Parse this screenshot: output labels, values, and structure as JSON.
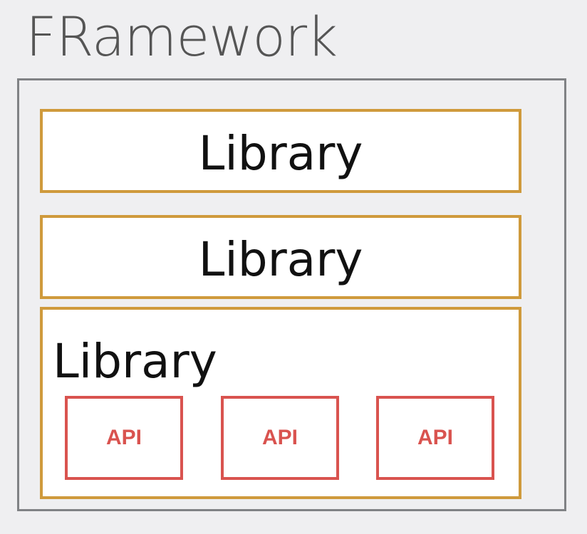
{
  "framework": {
    "title": "FRamework"
  },
  "libraries": [
    {
      "label": "Library"
    },
    {
      "label": "Library"
    },
    {
      "label": "Library"
    }
  ],
  "apis": [
    {
      "label": "API"
    },
    {
      "label": "API"
    },
    {
      "label": "API"
    }
  ],
  "colors": {
    "framework_border": "#808285",
    "library_border": "#cf9a3c",
    "api_border": "#d9534f",
    "background": "#efeff1"
  }
}
